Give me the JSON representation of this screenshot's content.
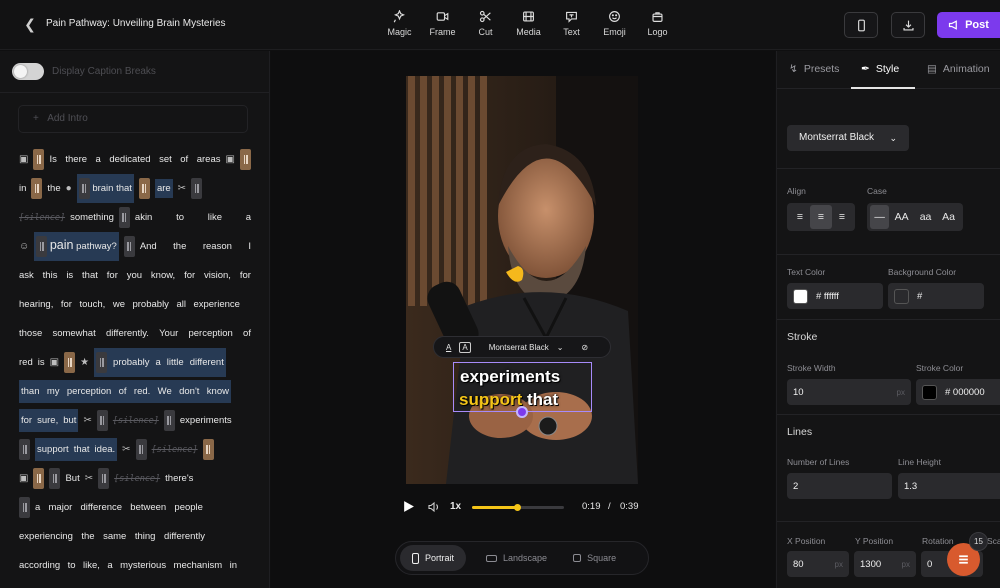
{
  "header": {
    "project_title": "Pain Pathway: Unveiling Brain Mysteries",
    "tools": [
      "Magic",
      "Frame",
      "Cut",
      "Media",
      "Text",
      "Emoji",
      "Logo"
    ],
    "post_label": "Post"
  },
  "left": {
    "toggle_label": "Display Caption Breaks",
    "add_intro": "Add Intro",
    "lines": [
      [
        "Is",
        "there",
        "a",
        "dedicated",
        "set",
        "of",
        "areas"
      ],
      [
        "in",
        "the",
        "brain",
        "that",
        "are"
      ],
      [
        "[silence]",
        "something",
        "akin",
        "to",
        "like",
        "a"
      ],
      [
        "pain",
        "pathway?",
        "And",
        "the",
        "reason",
        "I"
      ],
      [
        "ask",
        "this",
        "is",
        "that",
        "for",
        "you",
        "know,",
        "for",
        "vision,",
        "for"
      ],
      [
        "hearing,",
        "for",
        "touch,",
        "we",
        "probably",
        "all",
        "experience"
      ],
      [
        "those",
        "somewhat",
        "differently.",
        "Your",
        "perception",
        "of"
      ],
      [
        "red",
        "is",
        "probably",
        "a",
        "little",
        "different"
      ],
      [
        "than",
        "my",
        "perception",
        "of",
        "red.",
        "We",
        "don't",
        "know"
      ],
      [
        "for",
        "sure,",
        "but",
        "[silence]",
        "experiments"
      ],
      [
        "support",
        "that",
        "idea.",
        "[silence]"
      ],
      [
        "But",
        "[silence]",
        "there's"
      ],
      [
        "a",
        "major",
        "difference",
        "between",
        "people"
      ],
      [
        "experiencing",
        "the",
        "same",
        "thing",
        "differently"
      ],
      [
        "according",
        "to",
        "like,",
        "a",
        "mysterious",
        "mechanism",
        "in"
      ]
    ]
  },
  "video": {
    "caption_line1": "experiments",
    "caption_line2_highlight": "support",
    "caption_line2_rest": "that",
    "overlay_font": "Montserrat Black",
    "overlay_a": "A",
    "speed": "1x",
    "current_time": "0:19",
    "time_sep": "/",
    "total_time": "0:39",
    "progress": 0.49,
    "formats": [
      "Portrait",
      "Landscape",
      "Square"
    ],
    "active_format": "Portrait"
  },
  "right": {
    "tabs": [
      "Presets",
      "Style",
      "Animation"
    ],
    "active_tab": "Style",
    "font": "Montserrat Black",
    "align_label": "Align",
    "case_label": "Case",
    "case_options": [
      "—",
      "AA",
      "aa",
      "Aa"
    ],
    "text_color_label": "Text Color",
    "text_color": "# ffffff",
    "bg_color_label": "Background Color",
    "bg_color": "#",
    "stroke_label": "Stroke",
    "stroke_width_label": "Stroke Width",
    "stroke_width": "10",
    "stroke_unit": "px",
    "stroke_color_label": "Stroke Color",
    "stroke_color": "# 000000",
    "lines_label": "Lines",
    "num_lines_label": "Number of Lines",
    "num_lines": "2",
    "line_height_label": "Line Height",
    "line_height": "1.3",
    "x_pos_label": "X Position",
    "x_pos": "80",
    "y_pos_label": "Y Position",
    "y_pos": "1300",
    "rotation_label": "Rotation",
    "rotation": "0",
    "scale_label": "Scale",
    "badge_count": "15"
  },
  "colors": {
    "accent": "#7c3aed",
    "highlight": "#f5c518",
    "selection": "#a78bfa",
    "fab": "#d85a2e"
  }
}
